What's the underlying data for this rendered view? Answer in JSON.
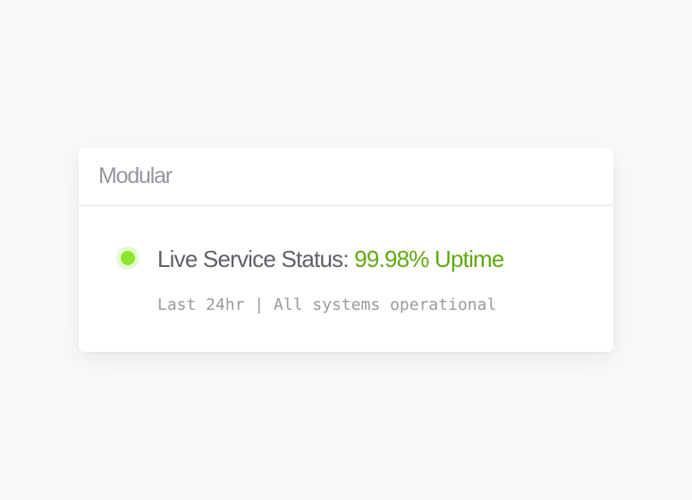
{
  "header": {
    "brand": "Modular"
  },
  "status": {
    "label": "Live Service Status:",
    "value": "99.98% Uptime",
    "detail": "Last 24hr | All systems operational",
    "indicator_icon": "status-online-dot",
    "indicator_color": "#8ee632",
    "value_color": "#62a812"
  }
}
